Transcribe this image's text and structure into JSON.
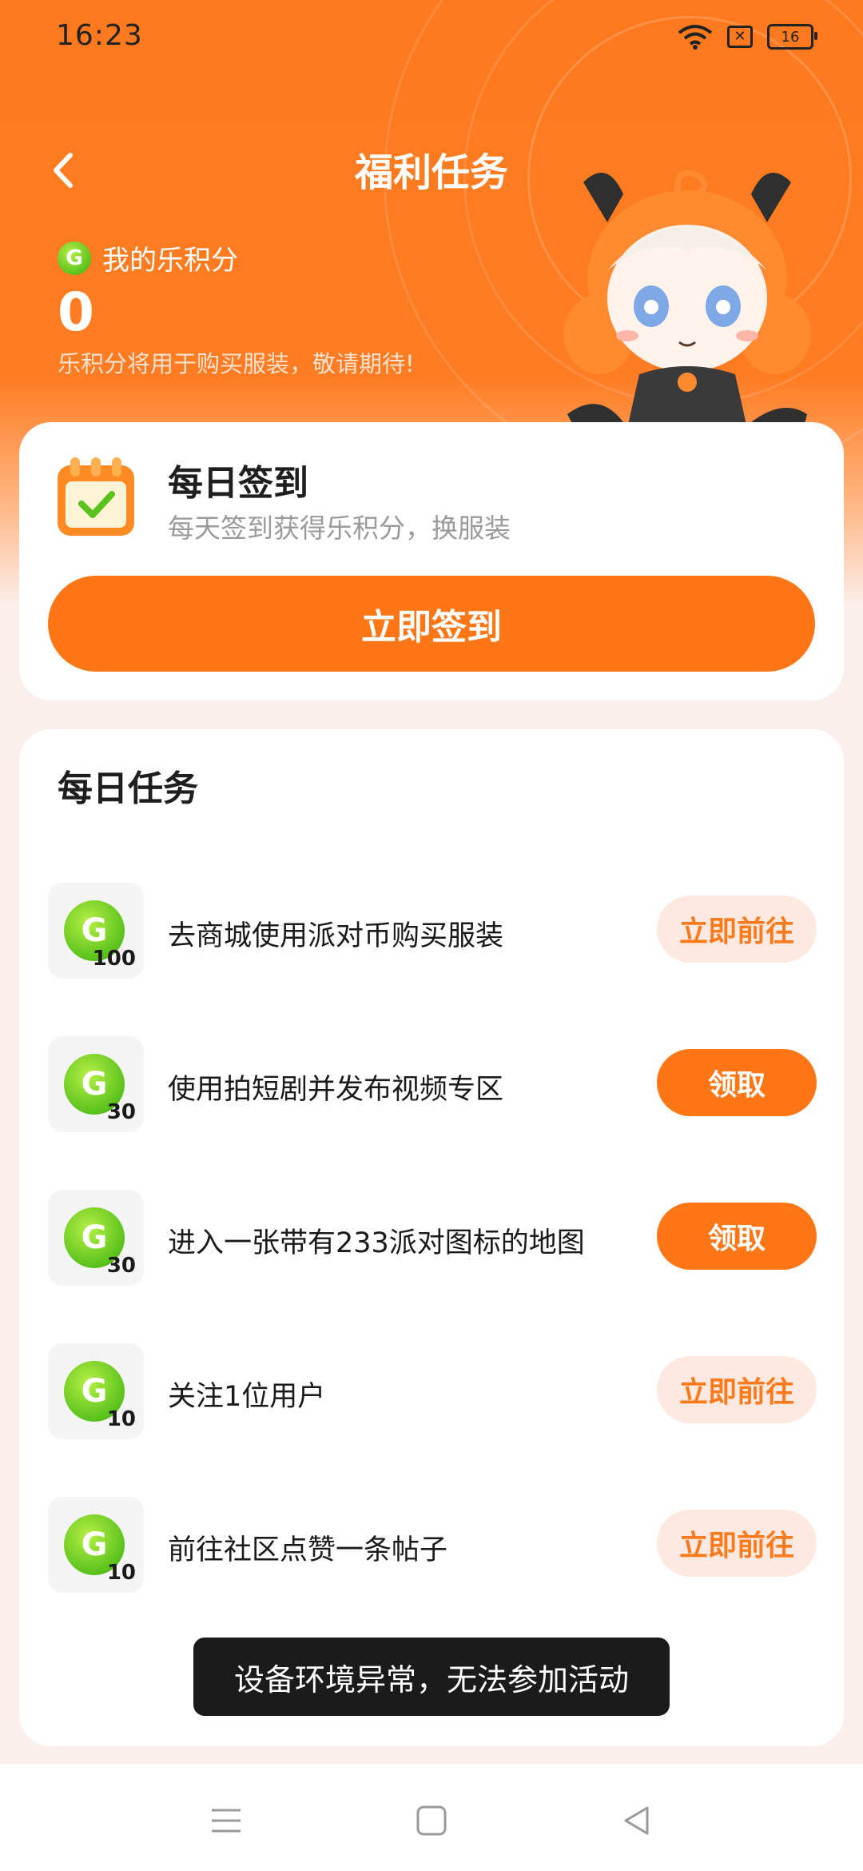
{
  "status_bar": {
    "time": "16:23",
    "battery": "16",
    "x_badge": "✕"
  },
  "header": {
    "title": "福利任务",
    "back_icon": "back-chevron-icon"
  },
  "points": {
    "label": "我的乐积分",
    "value": "0",
    "note": "乐积分将用于购买服装，敬请期待!",
    "coin_glyph": "G"
  },
  "checkin": {
    "title": "每日签到",
    "subtitle": "每天签到获得乐积分，换服装",
    "button": "立即签到"
  },
  "daily_tasks": {
    "title": "每日任务",
    "tasks": [
      {
        "points": "100",
        "label": "去商城使用派对币购买服装",
        "action": "立即前往",
        "style": "go"
      },
      {
        "points": "30",
        "label": "使用拍短剧并发布视频专区",
        "action": "领取",
        "style": "claim"
      },
      {
        "points": "30",
        "label": "进入一张带有233派对图标的地图",
        "action": "领取",
        "style": "claim"
      },
      {
        "points": "10",
        "label": "关注1位用户",
        "action": "立即前往",
        "style": "go"
      },
      {
        "points": "10",
        "label": "前往社区点赞一条帖子",
        "action": "立即前往",
        "style": "go"
      }
    ]
  },
  "toast": "设备环境异常，无法参加活动",
  "colors": {
    "accent": "#fe7616",
    "go_bg": "#fde9df",
    "coin": "#5bc21d"
  }
}
